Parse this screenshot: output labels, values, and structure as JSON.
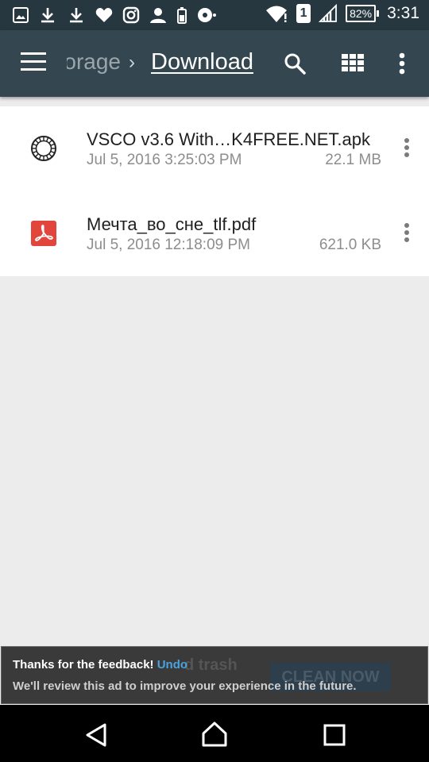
{
  "status_bar": {
    "sim_slot": "1",
    "battery_percent": "82%",
    "time": "3:31"
  },
  "app_bar": {
    "breadcrumb_previous": "orage",
    "breadcrumb_separator": "›",
    "breadcrumb_current": "Download",
    "icons": [
      "menu-icon",
      "search-icon",
      "grid-view-icon",
      "more-vert-icon"
    ]
  },
  "files": [
    {
      "icon": "vsco-app-icon",
      "name": "VSCO v3.6 With…K4FREE.NET.apk",
      "date": "Jul 5, 2016 3:25:03 PM",
      "size": "22.1 MB"
    },
    {
      "icon": "pdf-icon",
      "name": "Мечта_во_сне_tlf.pdf",
      "date": "Jul 5, 2016 12:18:09 PM",
      "size": "621.0 KB"
    }
  ],
  "ad_feedback": {
    "message": "Thanks for the feedback!",
    "undo_label": "Undo",
    "review_text": "We'll review this ad to improve your experience in the future.",
    "background_ad_text": "d trash",
    "background_ad_button": "CLEAN NOW"
  },
  "colors": {
    "status_bar": "#263740",
    "app_bar": "#344750",
    "undo_link": "#4aa3df",
    "pdf_red": "#e2453c"
  }
}
